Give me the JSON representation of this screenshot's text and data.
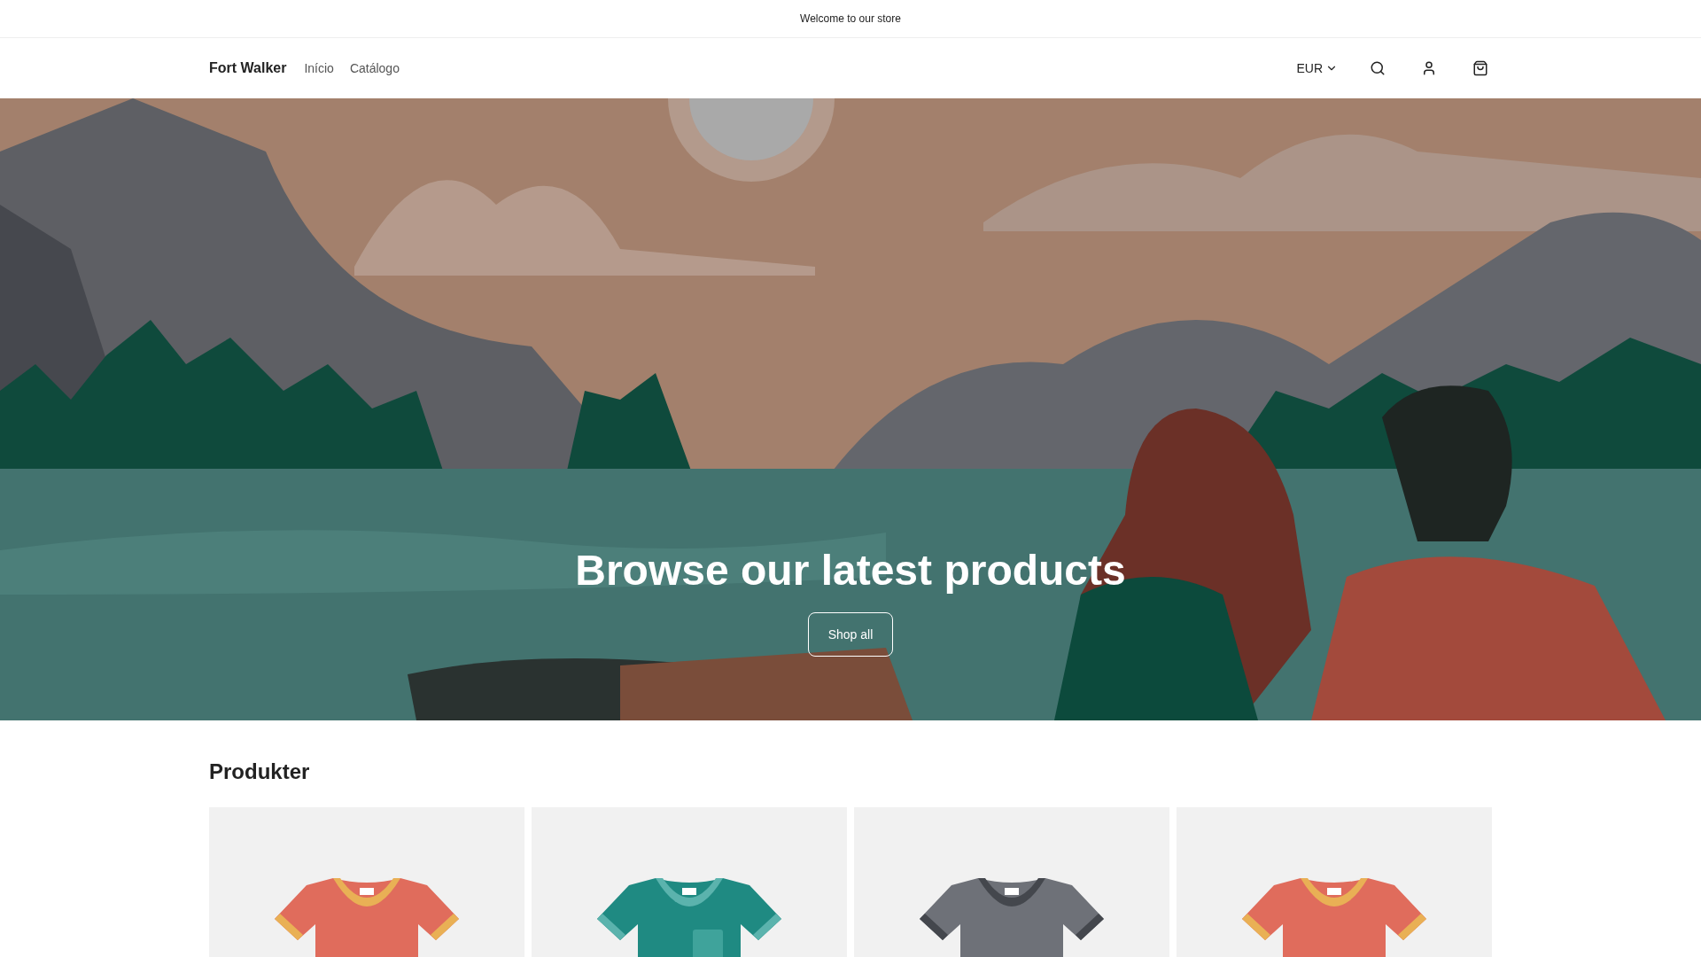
{
  "announcement": "Welcome to our store",
  "header": {
    "brand": "Fort Walker",
    "nav": [
      {
        "label": "Início"
      },
      {
        "label": "Catálogo"
      }
    ],
    "currency": "EUR"
  },
  "hero": {
    "heading": "Browse our latest products",
    "button": "Shop all"
  },
  "products": {
    "title": "Produkter",
    "items": [
      {
        "kind": "plain",
        "color": "#e06c5c"
      },
      {
        "kind": "pocket",
        "color": "#1f8a82"
      },
      {
        "kind": "print",
        "color": "#6e7178"
      },
      {
        "kind": "plain",
        "color": "#e06c5c"
      }
    ]
  }
}
